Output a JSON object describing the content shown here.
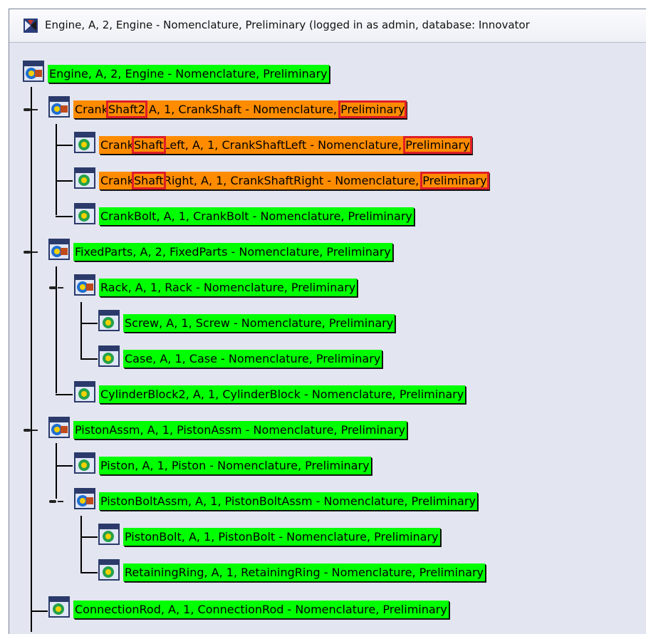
{
  "window": {
    "title": "Engine, A, 2, Engine - Nomenclature, Preliminary (logged in as admin, database: Innovator"
  },
  "tree": {
    "nodes": [
      {
        "label": "Engine, A, 2, Engine - Nomenclature, Preliminary",
        "highlight": "green",
        "icon": "assembly-icon"
      },
      {
        "label_parts": [
          "Crank",
          "Shaft2",
          " A, 1, CrankShaft - Nomenclature, ",
          "Preliminary"
        ],
        "highlight": "orange",
        "icon": "assembly-icon"
      },
      {
        "label_parts": [
          "Crank",
          "Shaft",
          "Left, A, 1, CrankShaftLeft - Nomenclature, ",
          "Preliminary"
        ],
        "highlight": "orange",
        "icon": "part-icon"
      },
      {
        "label_parts": [
          "Crank",
          "Shaft",
          "Right, A, 1, CrankShaftRight - Nomenclature, ",
          "Preliminary"
        ],
        "highlight": "orange",
        "icon": "part-icon"
      },
      {
        "label": "CrankBolt, A, 1, CrankBolt - Nomenclature, Preliminary",
        "highlight": "green",
        "icon": "part-icon"
      },
      {
        "label": "FixedParts, A, 2, FixedParts - Nomenclature, Preliminary",
        "highlight": "green",
        "icon": "assembly-icon"
      },
      {
        "label": "Rack, A, 1, Rack - Nomenclature, Preliminary",
        "highlight": "green",
        "icon": "assembly-icon"
      },
      {
        "label": "Screw, A, 1, Screw - Nomenclature, Preliminary",
        "highlight": "green",
        "icon": "part-icon"
      },
      {
        "label": "Case, A, 1, Case - Nomenclature, Preliminary",
        "highlight": "green",
        "icon": "part-icon"
      },
      {
        "label": "CylinderBlock2, A, 1, CylinderBlock - Nomenclature, Preliminary",
        "highlight": "green",
        "icon": "part-icon"
      },
      {
        "label": "PistonAssm, A, 1, PistonAssm - Nomenclature, Preliminary",
        "highlight": "green",
        "icon": "assembly-icon"
      },
      {
        "label": "Piston, A, 1, Piston - Nomenclature, Preliminary",
        "highlight": "green",
        "icon": "part-icon"
      },
      {
        "label": "PistonBoltAssm, A, 1, PistonBoltAssm - Nomenclature, Preliminary",
        "highlight": "green",
        "icon": "assembly-icon"
      },
      {
        "label": "PistonBolt, A, 1, PistonBolt - Nomenclature, Preliminary",
        "highlight": "green",
        "icon": "part-icon"
      },
      {
        "label": "RetainingRing, A, 1, RetainingRing - Nomenclature, Preliminary",
        "highlight": "green",
        "icon": "part-icon"
      },
      {
        "label": "ConnectionRod, A, 1, ConnectionRod - Nomenclature, Preliminary",
        "highlight": "green",
        "icon": "part-icon"
      }
    ]
  },
  "colors": {
    "match_highlight": "#00ff00",
    "mismatch_highlight": "#ff8c00",
    "annotation_box": "#e01e26"
  }
}
